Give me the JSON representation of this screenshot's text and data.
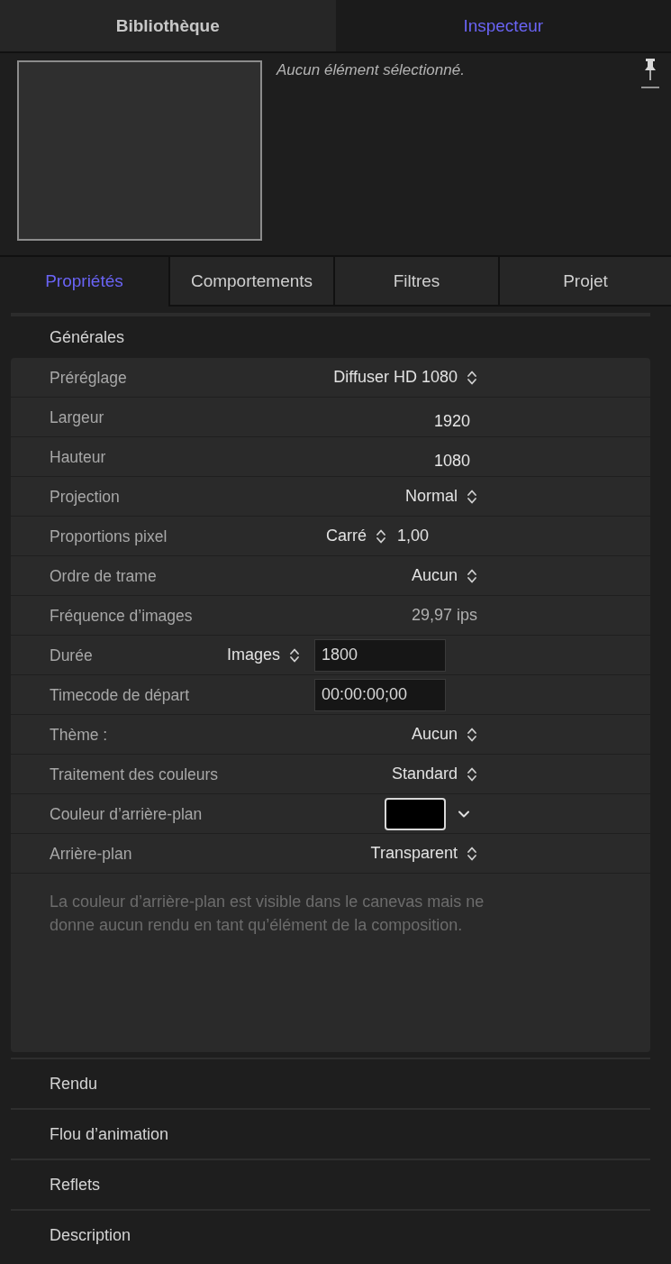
{
  "top_tabs": [
    {
      "label": "Bibliothèque",
      "selected": false
    },
    {
      "label": "Inspecteur",
      "selected": true
    }
  ],
  "preview": {
    "message": "Aucun élément sélectionné."
  },
  "inspector_tabs": [
    {
      "label": "Propriétés",
      "selected": true
    },
    {
      "label": "Comportements",
      "selected": false
    },
    {
      "label": "Filtres",
      "selected": false
    },
    {
      "label": "Projet",
      "selected": false
    }
  ],
  "sections": [
    {
      "title": "Générales",
      "expanded": true,
      "rows": [
        {
          "kind": "popup",
          "label": "Préréglage",
          "value": "Diffuser HD 1080"
        },
        {
          "kind": "number",
          "label": "Largeur",
          "value": "1920"
        },
        {
          "kind": "number",
          "label": "Hauteur",
          "value": "1080"
        },
        {
          "kind": "popup",
          "label": "Projection",
          "value": "Normal"
        },
        {
          "kind": "popup_number",
          "label": "Proportions pixel",
          "value": "Carré",
          "number": "1,00"
        },
        {
          "kind": "popup",
          "label": "Ordre de trame",
          "value": "Aucun"
        },
        {
          "kind": "readout",
          "label": "Fréquence d’images",
          "value": "29,97 ips"
        },
        {
          "kind": "unit_field",
          "label": "Durée",
          "unit": "Images",
          "value": "1800"
        },
        {
          "kind": "field",
          "label": "Timecode de départ",
          "value": "00:00:00;00"
        },
        {
          "kind": "popup",
          "label": "Thème :",
          "value": "Aucun"
        },
        {
          "kind": "popup",
          "label": "Traitement des couleurs",
          "value": "Standard"
        },
        {
          "kind": "color",
          "label": "Couleur d’arrière-plan",
          "color": "#000000"
        },
        {
          "kind": "popup",
          "label": "Arrière-plan",
          "value": "Transparent"
        }
      ],
      "note": "La couleur d’arrière-plan est visible dans le canevas mais ne donne aucun rendu en tant qu’élément de la composition."
    },
    {
      "title": "Rendu",
      "expanded": false
    },
    {
      "title": "Flou d’animation",
      "expanded": false
    },
    {
      "title": "Reflets",
      "expanded": false
    },
    {
      "title": "Description",
      "expanded": false
    }
  ]
}
